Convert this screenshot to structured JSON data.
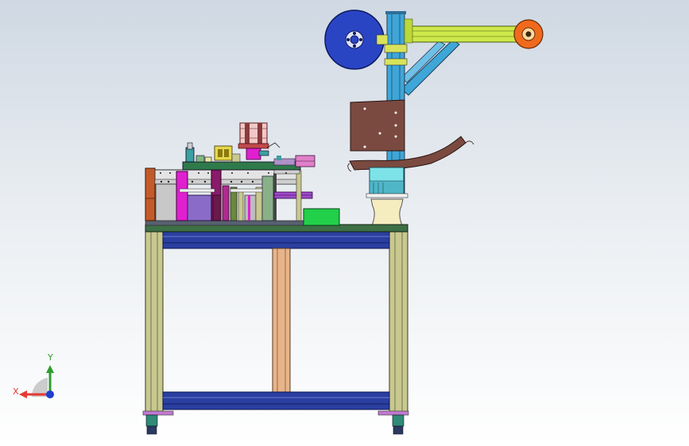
{
  "viewport": {
    "background_top": "#cfd8e3",
    "background_bottom": "#ffffff"
  },
  "triad": {
    "x_label": "X",
    "y_label": "Y",
    "x_color": "#e53935",
    "y_color": "#2e9d2e",
    "z_color": "#1e3fd0"
  },
  "colors": {
    "frame_leg": "#c8c890",
    "table_top": "#3e7046",
    "blue_rail": "#2a3fa0",
    "column_orange": "#e8b48a",
    "upright_blue": "#3fa6d8",
    "arm_yellow_green": "#cde94a",
    "reel_blue": "#2a45c4",
    "reel_orange": "#f06a1e",
    "brown_block": "#7a4a40",
    "magenta": "#e020d0",
    "green_box": "#22d04a",
    "pink_cylinder": "#f2c8c8",
    "cyan_block": "#7de3e8",
    "cream_base": "#f5ecc0"
  }
}
